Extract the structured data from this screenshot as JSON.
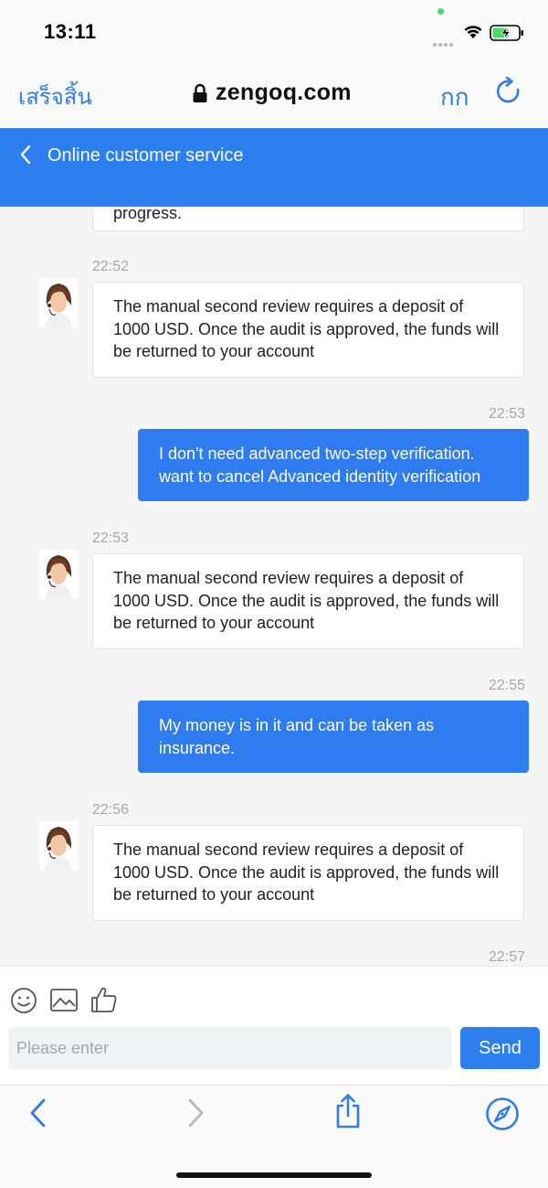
{
  "status_bar": {
    "time": "13:11"
  },
  "browser": {
    "done_label": "เสร็จสิ้น",
    "url": "zengoq.com",
    "text_size_label": "กก"
  },
  "header": {
    "title": "Online customer service"
  },
  "messages": [
    {
      "side": "agent",
      "text": "progress."
    },
    {
      "side": "agent",
      "time": "22:52",
      "text": "The manual second review requires a deposit of 1000 USD. Once the audit is approved, the funds will be returned to your account"
    },
    {
      "side": "user",
      "time": "22:53",
      "text": "I don't need advanced two-step verification. want to cancel Advanced identity verification"
    },
    {
      "side": "agent",
      "time": "22:53",
      "text": "The manual second review requires a deposit of 1000 USD. Once the audit is approved, the funds will be returned to your account"
    },
    {
      "side": "user",
      "time": "22:55",
      "text": "My money is in it and can be taken as insurance."
    },
    {
      "side": "agent",
      "time": "22:56",
      "text": "The manual second review requires a deposit of 1000 USD. Once the audit is approved, the funds will be returned to your account"
    },
    {
      "side": "agent",
      "time": "22:57",
      "text": ""
    }
  ],
  "composer": {
    "tools": [
      "emoji-icon",
      "image-icon",
      "thumbs-up-icon"
    ],
    "placeholder": "Please enter",
    "send_label": "Send"
  },
  "colors": {
    "accent": "#2d7ff0",
    "user_bubble": "#2f7bf0",
    "agent_bubble": "#ffffff",
    "background": "#f5f5f5",
    "timestamp": "#a6a6a6"
  }
}
